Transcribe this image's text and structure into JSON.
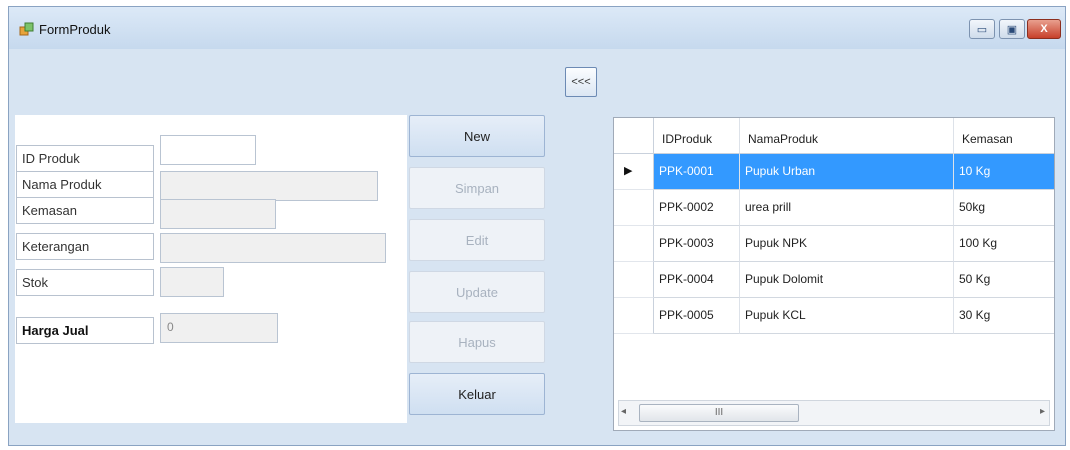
{
  "window": {
    "title": "FormProduk",
    "close_symbol": "X",
    "min_symbol": "▭",
    "max_symbol": "▣"
  },
  "collapse_button": "<<<",
  "form": {
    "fields": [
      {
        "label": "ID Produk",
        "value": ""
      },
      {
        "label": "Nama Produk",
        "value": ""
      },
      {
        "label": "Kemasan",
        "value": ""
      },
      {
        "label": "Keterangan",
        "value": ""
      },
      {
        "label": "Stok",
        "value": ""
      },
      {
        "label": "Harga Jual",
        "value": "0"
      }
    ]
  },
  "buttons": {
    "new": "New",
    "simpan": "Simpan",
    "edit": "Edit",
    "update": "Update",
    "hapus": "Hapus",
    "keluar": "Keluar"
  },
  "grid": {
    "columns": [
      "IDProduk",
      "NamaProduk",
      "Kemasan"
    ],
    "rows": [
      [
        "PPK-0001",
        "Pupuk Urban",
        "10 Kg"
      ],
      [
        "PPK-0002",
        "urea prill",
        "50kg"
      ],
      [
        "PPK-0003",
        "Pupuk NPK",
        "100 Kg"
      ],
      [
        "PPK-0004",
        "Pupuk Dolomit",
        "50 Kg"
      ],
      [
        "PPK-0005",
        "Pupuk KCL",
        "30 Kg"
      ]
    ],
    "current_row_marker": "▶",
    "scroll_thumb_glyph": "III",
    "scroll_left": "◂",
    "scroll_right": "▸"
  },
  "colors": {
    "selection": "#3399ff",
    "window_bg": "#d7e4f2"
  }
}
